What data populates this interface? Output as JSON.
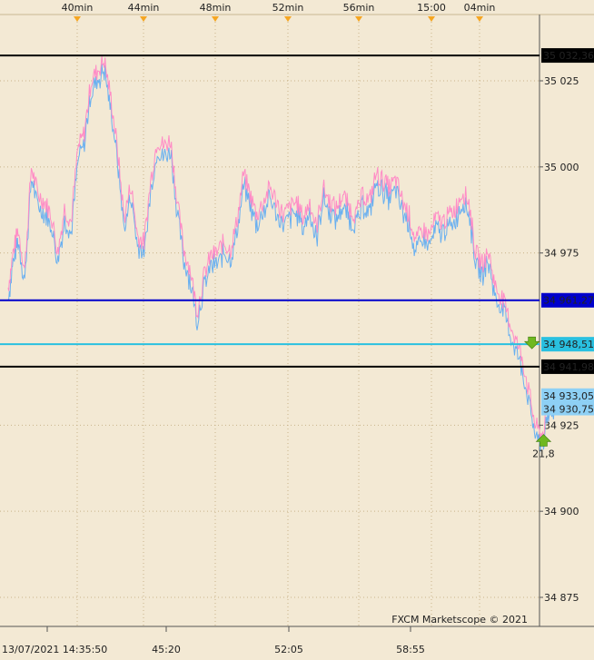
{
  "chart_data": {
    "type": "line",
    "top_time_labels": [
      "40min",
      "44min",
      "48min",
      "52min",
      "56min",
      "15:00",
      "04min"
    ],
    "bottom_time_labels": [
      "13/07/2021 14:35:50",
      "45:20",
      "52:05",
      "58:55"
    ],
    "y_ticks": [
      35025,
      35000,
      34975,
      34925,
      34900,
      34875
    ],
    "y_tick_labels": [
      "35 025",
      "35 000",
      "34 975",
      "34 925",
      "34 900",
      "34 875"
    ],
    "ylim": [
      34867,
      35040
    ],
    "xlim_min": [
      0,
      37
    ],
    "series": [
      {
        "color": "#ff8cc6",
        "values_note": "",
        "points": [
          [
            0,
            34965
          ],
          [
            0.3,
            34975
          ],
          [
            0.6,
            34982
          ],
          [
            1,
            34970
          ],
          [
            1.4,
            35000
          ],
          [
            1.8,
            34992
          ],
          [
            2.2,
            34990
          ],
          [
            2.6,
            34986
          ],
          [
            3.0,
            34975
          ],
          [
            3.4,
            34988
          ],
          [
            3.8,
            34984
          ],
          [
            4.2,
            35005
          ],
          [
            4.6,
            35010
          ],
          [
            5.0,
            35025
          ],
          [
            5.4,
            35028
          ],
          [
            5.8,
            35031
          ],
          [
            6.2,
            35020
          ],
          [
            6.6,
            35005
          ],
          [
            7.0,
            34985
          ],
          [
            7.4,
            34995
          ],
          [
            7.8,
            34980
          ],
          [
            8.2,
            34978
          ],
          [
            8.6,
            34996
          ],
          [
            9.0,
            35008
          ],
          [
            9.4,
            35006
          ],
          [
            9.8,
            35008
          ],
          [
            10.2,
            34990
          ],
          [
            10.6,
            34976
          ],
          [
            11.0,
            34970
          ],
          [
            11.4,
            34958
          ],
          [
            11.8,
            34968
          ],
          [
            12.2,
            34974
          ],
          [
            12.6,
            34975
          ],
          [
            13.0,
            34978
          ],
          [
            13.4,
            34976
          ],
          [
            13.8,
            34984
          ],
          [
            14.2,
            34998
          ],
          [
            14.6,
            34992
          ],
          [
            15.0,
            34986
          ],
          [
            15.4,
            34990
          ],
          [
            15.8,
            34994
          ],
          [
            16.2,
            34990
          ],
          [
            16.6,
            34986
          ],
          [
            17.0,
            34988
          ],
          [
            17.4,
            34990
          ],
          [
            17.8,
            34985
          ],
          [
            18.2,
            34990
          ],
          [
            18.6,
            34982
          ],
          [
            19.0,
            34994
          ],
          [
            19.4,
            34990
          ],
          [
            19.8,
            34988
          ],
          [
            20.2,
            34992
          ],
          [
            20.6,
            34988
          ],
          [
            21.0,
            34986
          ],
          [
            21.4,
            34992
          ],
          [
            21.8,
            34990
          ],
          [
            22.2,
            34998
          ],
          [
            22.6,
            34996
          ],
          [
            23.0,
            34994
          ],
          [
            23.4,
            34996
          ],
          [
            23.8,
            34990
          ],
          [
            24.2,
            34986
          ],
          [
            24.6,
            34978
          ],
          [
            25.0,
            34982
          ],
          [
            25.4,
            34980
          ],
          [
            25.8,
            34985
          ],
          [
            26.2,
            34984
          ],
          [
            26.6,
            34986
          ],
          [
            27.0,
            34988
          ],
          [
            27.4,
            34993
          ],
          [
            27.8,
            34990
          ],
          [
            28.2,
            34975
          ],
          [
            28.6,
            34972
          ],
          [
            29.0,
            34975
          ],
          [
            29.4,
            34965
          ],
          [
            29.8,
            34962
          ],
          [
            30.2,
            34956
          ],
          [
            30.6,
            34950
          ],
          [
            31.0,
            34945
          ],
          [
            31.4,
            34935
          ],
          [
            31.8,
            34925
          ],
          [
            32.2,
            34922
          ],
          [
            32.6,
            34930
          ],
          [
            33.0,
            34934
          ]
        ]
      },
      {
        "color": "#6ab0f0",
        "points": []
      }
    ],
    "hlines": [
      {
        "value": 35032.36,
        "label": "35 032,36",
        "line_color": "#000000",
        "label_bg": "#000000",
        "label_fg": "#ffffff"
      },
      {
        "value": 34961.27,
        "label": "34 961,27",
        "line_color": "#0000cc",
        "label_bg": "#0000cc",
        "label_fg": "#ffffff"
      },
      {
        "value": 34948.51,
        "label": "34 948,51",
        "line_color": "#29c0e0",
        "label_bg": "#29c0e0",
        "label_fg": "#000000"
      },
      {
        "value": 34941.98,
        "label": "34 941,98",
        "line_color": "#000000",
        "label_bg": "#000000",
        "label_fg": "#ffffff"
      }
    ],
    "price_tags": [
      {
        "value": 34933.05,
        "label": "34 933,05",
        "bg": "#8ed0f5",
        "fg": "#000000"
      },
      {
        "value": 34930.75,
        "label": "34 930,75",
        "bg": "#8ed0f5",
        "fg": "#000000"
      }
    ],
    "markers": [
      {
        "type": "down-arrow",
        "x_min": 31.6,
        "value": 34948.5,
        "color": "#6fb820"
      },
      {
        "type": "up-arrow",
        "x_min": 32.3,
        "value": 34921,
        "color": "#6fb820",
        "label": "21,8"
      }
    ],
    "watermark": "FXCM Marketscope © 2021",
    "grid": true
  }
}
